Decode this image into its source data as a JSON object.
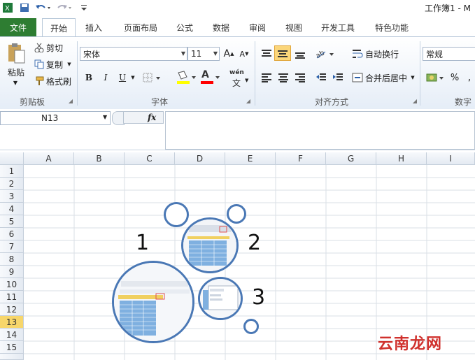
{
  "titlebar": {
    "title": "工作簿1 - M"
  },
  "tabs": [
    {
      "label": "文件"
    },
    {
      "label": "开始"
    },
    {
      "label": "插入"
    },
    {
      "label": "页面布局"
    },
    {
      "label": "公式"
    },
    {
      "label": "数据"
    },
    {
      "label": "审阅"
    },
    {
      "label": "视图"
    },
    {
      "label": "开发工具"
    },
    {
      "label": "特色功能"
    }
  ],
  "ribbon": {
    "clipboard": {
      "paste": "粘贴",
      "cut": "剪切",
      "copy": "复制",
      "painter": "格式刷",
      "group": "剪贴板"
    },
    "font": {
      "name": "宋体",
      "size": "11",
      "grow": "A",
      "shrink": "A",
      "bold": "B",
      "italic": "I",
      "underline": "U",
      "font_color": "A",
      "phonetic": "wén",
      "phonetic2": "文",
      "group": "字体"
    },
    "align": {
      "wrap": "自动换行",
      "merge": "合并后居中",
      "group": "对齐方式"
    },
    "number": {
      "format": "常规",
      "percent": "%",
      "group": "数字"
    }
  },
  "formula_bar": {
    "cell_ref": "N13",
    "fx": "fx"
  },
  "grid": {
    "columns": [
      "A",
      "B",
      "C",
      "D",
      "E",
      "F",
      "G",
      "H",
      "I"
    ],
    "rows": [
      "1",
      "2",
      "3",
      "4",
      "5",
      "6",
      "7",
      "8",
      "9",
      "10",
      "11",
      "12",
      "13",
      "14",
      "15"
    ],
    "selected_row": "13"
  },
  "annotations": {
    "n1": "1",
    "n2": "2",
    "n3": "3"
  },
  "watermark": "云南龙网",
  "colors": {
    "file_tab": "#2e7d32",
    "accent_blue": "#4a78b5",
    "selected_row": "#f7d66b",
    "watermark_red": "#d0312d"
  }
}
